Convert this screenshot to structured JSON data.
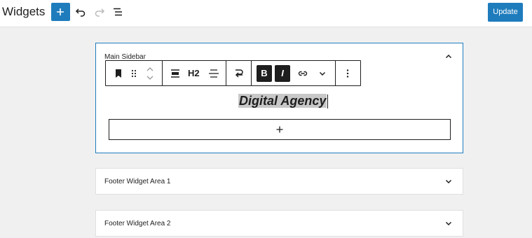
{
  "header": {
    "title": "Widgets",
    "update_label": "Update",
    "icons": [
      "plus-icon",
      "undo-icon",
      "redo-icon",
      "list-view-icon"
    ]
  },
  "main_sidebar": {
    "label": "Main Sidebar",
    "expanded": true,
    "toolbar": {
      "heading_level": "H2",
      "bold_label": "B",
      "italic_label": "I",
      "icons": [
        "bookmark-icon",
        "drag-handle-icon",
        "move-up-icon",
        "move-down-icon",
        "align-icon",
        "text-align-icon",
        "transform-icon",
        "link-icon",
        "chevron-down-icon",
        "more-options-icon"
      ]
    },
    "heading_text": "Digital Agency"
  },
  "footer_areas": [
    {
      "label": "Footer Widget Area 1",
      "expanded": false
    },
    {
      "label": "Footer Widget Area 2",
      "expanded": false
    }
  ],
  "colors": {
    "accent": "#1e7cbd",
    "background": "#f0f0f0",
    "text": "#1e1e1e",
    "selection": "#c8c8c8"
  }
}
